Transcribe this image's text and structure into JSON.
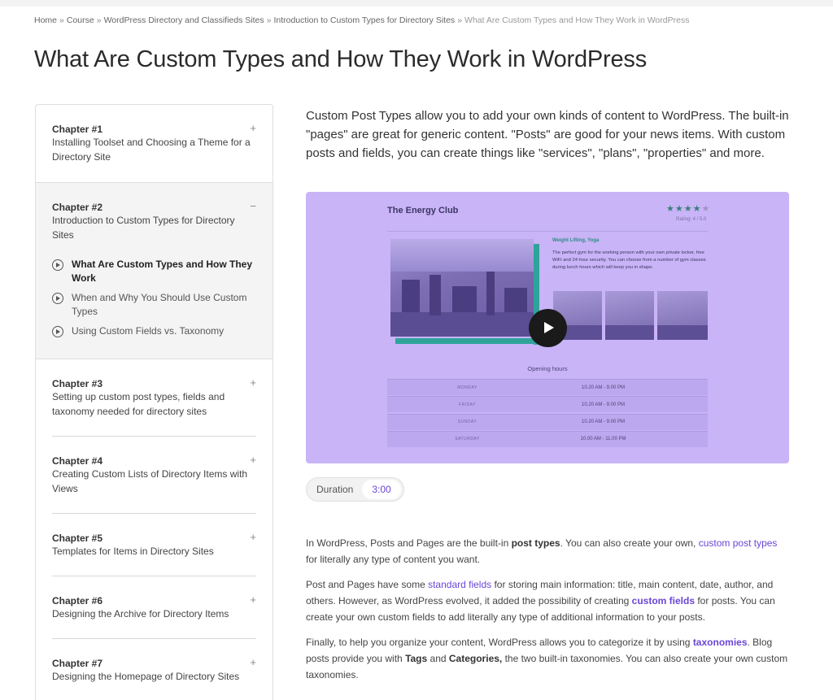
{
  "breadcrumb": {
    "items": [
      "Home",
      "Course",
      "WordPress Directory and Classifieds Sites",
      "Introduction to Custom Types for Directory Sites"
    ],
    "separator": "»",
    "current": "What Are Custom Types and How They Work in WordPress"
  },
  "page": {
    "title": "What Are Custom Types and How They Work in WordPress"
  },
  "sidebar": {
    "chapters": [
      {
        "number": "Chapter #1",
        "title": "Installing Toolset and Choosing a Theme for a Directory Site",
        "toggle": "+"
      },
      {
        "number": "Chapter #2",
        "title": "Introduction to Custom Types for Directory Sites",
        "toggle": "−",
        "lessons": [
          {
            "title": "What Are Custom Types and How They Work",
            "active": true
          },
          {
            "title": "When and Why You Should Use Custom Types",
            "active": false
          },
          {
            "title": "Using Custom Fields vs. Taxonomy",
            "active": false
          }
        ]
      },
      {
        "number": "Chapter #3",
        "title": "Setting up custom post types, fields and taxonomy needed for directory sites",
        "toggle": "+"
      },
      {
        "number": "Chapter #4",
        "title": "Creating Custom Lists of Directory Items with Views",
        "toggle": "+"
      },
      {
        "number": "Chapter #5",
        "title": "Templates for Items in Directory Sites",
        "toggle": "+"
      },
      {
        "number": "Chapter #6",
        "title": "Designing the Archive for Directory Items",
        "toggle": "+"
      },
      {
        "number": "Chapter #7",
        "title": "Designing the Homepage of Directory Sites",
        "toggle": "+"
      }
    ]
  },
  "main": {
    "lead": "Custom Post Types allow you to add your own kinds of content to WordPress. The built-in \"pages\" are great for generic content. \"Posts\" are good for your news items. With custom posts and fields, you can create things like \"services\", \"plans\", \"properties\" and more.",
    "video": {
      "brand": "The Energy Club",
      "stars": "★★★★",
      "star_dim": "★",
      "rating": "Rating: 4 / 5.0",
      "tag": "Weight Lifting, Yoga",
      "description": "The perfect gym for the working person with your own private locker, free WiFi and 24 hour security. You can choose from a number of gym classes during lunch hours which will keep you in shape.",
      "hours_title": "Opening hours",
      "hours": [
        {
          "day": "MONDAY",
          "time": "10.20 AM - 9.00 PM"
        },
        {
          "day": "FRIDAY",
          "time": "10.20 AM - 9.00 PM"
        },
        {
          "day": "SUNDAY",
          "time": "10.20 AM - 9.00 PM"
        },
        {
          "day": "SATURDAY",
          "time": "10.00 AM - 11.00 PM"
        }
      ],
      "purple": "#c8b4f6",
      "teal": "#2fa39a"
    },
    "duration": {
      "label": "Duration",
      "value": "3:00"
    },
    "p1": {
      "t1": "In WordPress, Posts and Pages are the built-in ",
      "b1": "post types",
      "t2": ". You can also create your own, ",
      "l1": "custom post types",
      "t3": " for literally any type of content you want."
    },
    "p2": {
      "t1": "Post and Pages have some ",
      "l1": "standard fields",
      "t2": " for storing main information: title, main content, date, author, and others. However, as WordPress evolved, it added the possibility of creating ",
      "l2": "custom fields",
      "t3": " for posts. You can create your own custom fields to add literally any type of additional information to your posts."
    },
    "p3": {
      "t1": "Finally, to help you organize your content, WordPress allows you to categorize it by using ",
      "l1": "taxonomies",
      "t2": ". Blog posts provide you with ",
      "b1": "Tags",
      "t3": " and ",
      "b2": "Categories,",
      "t4": " the two built-in taxonomies. You can also create your own custom taxonomies."
    },
    "link_color": "#6a45d6"
  }
}
